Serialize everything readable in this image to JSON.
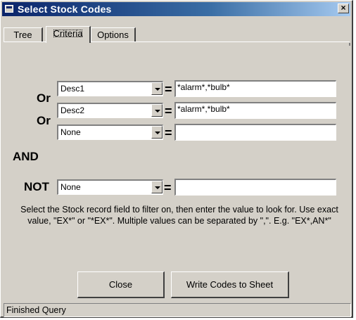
{
  "window": {
    "title": "Select Stock Codes",
    "close_glyph": "×"
  },
  "tabs": [
    {
      "label": "Tree"
    },
    {
      "label": "Criteria",
      "active": true
    },
    {
      "label": "Options"
    }
  ],
  "criteria": {
    "rows": [
      {
        "connector": "Or",
        "field": "Desc1",
        "operator": "=",
        "value": "*alarm*,*bulb*"
      },
      {
        "connector": "Or",
        "field": "Desc2",
        "operator": "=",
        "value": "*alarm*,*bulb*"
      },
      {
        "connector": "",
        "field": "None",
        "operator": "=",
        "value": ""
      }
    ],
    "and_label": "AND",
    "not_row": {
      "connector": "NOT",
      "field": "None",
      "operator": "=",
      "value": ""
    }
  },
  "help_text": "Select the Stock record field to filter on, then enter the value to look for. Use exact value, \"EX*\" or \"*EX*\".  Multiple values can be separated by \",\". E.g. \"EX*,AN*\"",
  "buttons": {
    "close": "Close",
    "write": "Write Codes to Sheet"
  },
  "status": {
    "text": "Finished Query"
  }
}
